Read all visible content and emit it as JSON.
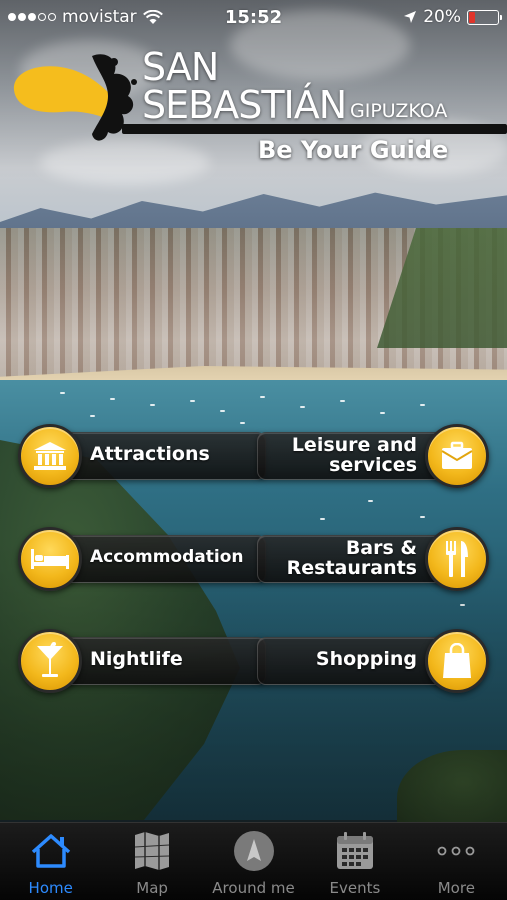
{
  "status_bar": {
    "carrier": "movistar",
    "time": "15:52",
    "battery_percent": "20%",
    "battery_level": 0.2,
    "signal_bars": 3,
    "signal_total": 5
  },
  "logo": {
    "line1": "SAN",
    "line2": "SEBASTIÁN",
    "region": "GIPUZKOA",
    "tagline": "Be Your Guide"
  },
  "menu": {
    "attractions": "Attractions",
    "leisure_line1": "Leisure and",
    "leisure_line2": "services",
    "accommodation": "Accommodation",
    "bars_line1": "Bars &",
    "bars_line2": "Restaurants",
    "nightlife": "Nightlife",
    "shopping": "Shopping"
  },
  "tabs": {
    "home": "Home",
    "map": "Map",
    "around_me": "Around me",
    "events": "Events",
    "more": "More",
    "active": "home"
  },
  "colors": {
    "accent": "#2d8bff",
    "gold": "#f3b81c",
    "battery_low": "#e0352b"
  }
}
